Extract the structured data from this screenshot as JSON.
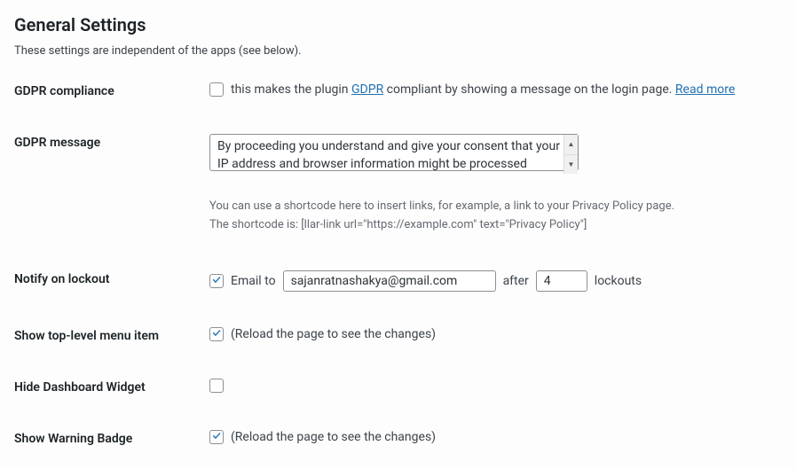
{
  "section": {
    "title": "General Settings",
    "description": "These settings are independent of the apps (see below)."
  },
  "gdpr_compliance": {
    "label": "GDPR compliance",
    "checked": false,
    "text_prefix": "this makes the plugin ",
    "link_gdpr": "GDPR",
    "text_middle": " compliant by showing a message on the login page. ",
    "link_readmore": "Read more"
  },
  "gdpr_message": {
    "label": "GDPR message",
    "value": "By proceeding you understand and give your consent that your IP address and browser information might be processed",
    "helper_line1": "You can use a shortcode here to insert links, for example, a link to your Privacy Policy page.",
    "helper_line2": "The shortcode is: [llar-link url=\"https://example.com\" text=\"Privacy Policy\"]"
  },
  "notify_lockout": {
    "label": "Notify on lockout",
    "checked": true,
    "text_email_to": "Email to",
    "email_value": "sajanratnashakya@gmail.com",
    "text_after": "after",
    "count_value": "4",
    "text_lockouts": "lockouts"
  },
  "show_top_menu": {
    "label": "Show top-level menu item",
    "checked": true,
    "note": "(Reload the page to see the changes)"
  },
  "hide_dashboard": {
    "label": "Hide Dashboard Widget",
    "checked": false
  },
  "show_warning_badge": {
    "label": "Show Warning Badge",
    "checked": true,
    "note": "(Reload the page to see the changes)"
  }
}
